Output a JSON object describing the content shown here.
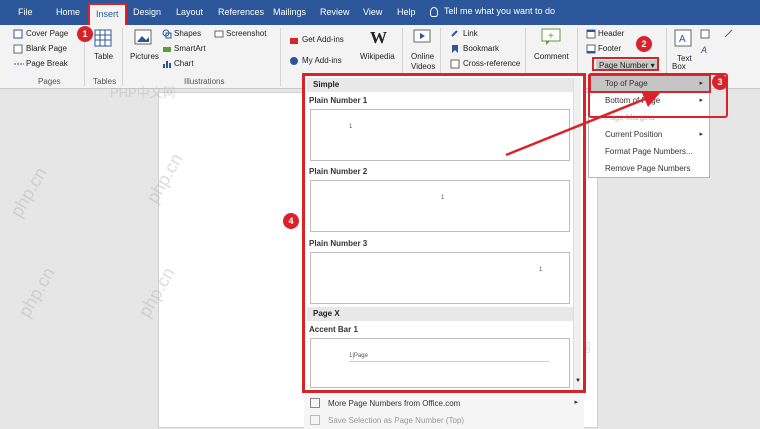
{
  "tabs": [
    "File",
    "Home",
    "Insert",
    "Design",
    "Layout",
    "References",
    "Mailings",
    "Review",
    "View",
    "Help"
  ],
  "tell_me": "Tell me what you want to do",
  "ribbon": {
    "pages": {
      "cover_page": "Cover Page",
      "blank_page": "Blank Page",
      "page_break": "Page Break",
      "label": "Pages"
    },
    "tables": {
      "table": "Table",
      "label": "Tables"
    },
    "illustrations": {
      "pictures": "Pictures",
      "shapes": "Shapes",
      "smartart": "SmartArt",
      "chart": "Chart",
      "screenshot": "Screenshot",
      "label": "Illustrations"
    },
    "addins": {
      "get_addins": "Get Add-ins",
      "my_addins": "My Add-ins",
      "wikipedia": "Wikipedia"
    },
    "media": {
      "online": "Online",
      "videos": "Videos"
    },
    "links": {
      "link": "Link",
      "bookmark": "Bookmark",
      "cross_reference": "Cross-reference"
    },
    "comments": {
      "comment": "Comment"
    },
    "header_footer": {
      "header": "Header",
      "footer": "Footer",
      "page_number": "Page Number"
    },
    "text": {
      "text_box": "Box",
      "text": "Text"
    }
  },
  "page_number_menu": [
    "Top of Page",
    "Bottom of Page",
    "Page Margins",
    "Current Position",
    "Format Page Numbers...",
    "Remove Page Numbers"
  ],
  "gallery": {
    "section_simple": "Simple",
    "items": [
      "Plain Number 1",
      "Plain Number 2",
      "Plain Number 3"
    ],
    "section_pagex": "Page X",
    "accent": "Accent Bar 1",
    "thumb_num": "1",
    "accent_thumb": "1|Page"
  },
  "more": {
    "more_numbers": "More Page Numbers from Office.com",
    "save_selection": "Save Selection as Page Number (Top)"
  },
  "badges": [
    "1",
    "2",
    "3",
    "4"
  ],
  "watermarks": {
    "php_cn": "php.cn",
    "php_cn_zh": "PHP中文网"
  },
  "colors": {
    "ribbon_blue": "#2b579a",
    "highlight_red": "#d9232a"
  }
}
